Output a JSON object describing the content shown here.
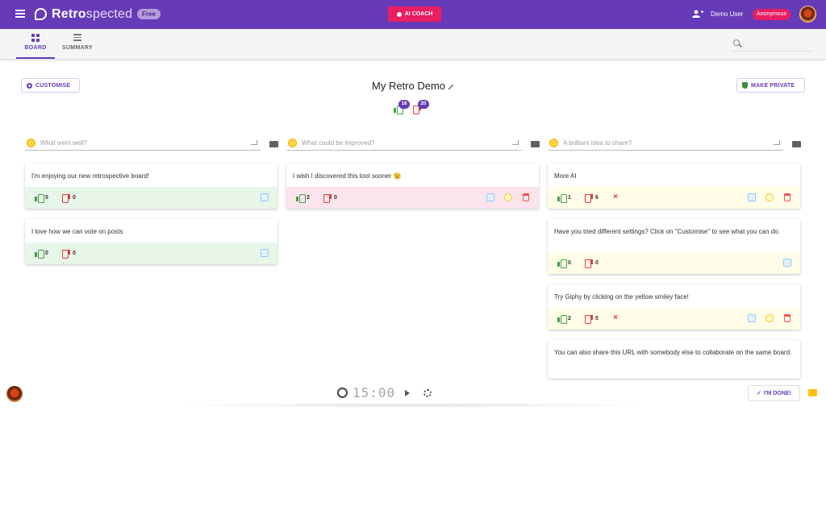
{
  "app": {
    "brand_bold": "Retro",
    "brand_light": "spected",
    "free_label": "Free",
    "ai_coach_label": "AI COACH",
    "user_name": "Demo User",
    "user_badge": "Anonymous"
  },
  "tabs": [
    {
      "label": "BOARD",
      "icon": "board-grid-icon",
      "active": true
    },
    {
      "label": "SUMMARY",
      "icon": "list-icon",
      "active": false
    }
  ],
  "search": {
    "placeholder": ""
  },
  "board": {
    "title": "My Retro Demo",
    "customise_label": "CUSTOMISE",
    "make_private_label": "MAKE PRIVATE",
    "total_up": "18",
    "total_down": "20"
  },
  "columns": [
    {
      "placeholder": "What went well?",
      "color": "#e8f5e9",
      "cards": [
        {
          "text": "I'm enjoying our new retrospective board!",
          "up": "5",
          "down": "0"
        },
        {
          "text": "I love how we can vote on posts",
          "up": "0",
          "down": "0"
        }
      ]
    },
    {
      "placeholder": "What could be improved?",
      "color": "#fce4ec",
      "cards": [
        {
          "text": "I wish I discovered this tool sooner 😉",
          "up": "2",
          "down": "0"
        }
      ]
    },
    {
      "placeholder": "A brilliant idea to share?",
      "color": "#fffde7",
      "cards": [
        {
          "text": "More AI",
          "up": "1",
          "down": "6"
        },
        {
          "text": "Have you tried different settings? Click on \"Customise\" to see what you can do.",
          "up": "0",
          "down": "0"
        },
        {
          "text": "Try Giphy by clicking on the yellow smiley face!",
          "up": "2",
          "down": "0"
        },
        {
          "text": "You can also share this URL with somebody else to collaborate on the same board.",
          "up": "",
          "down": ""
        }
      ]
    }
  ],
  "footer": {
    "timer": "15:00",
    "done_label": "I'M DONE!"
  },
  "colors": {
    "primary": "#673ab7",
    "accent": "#e91e63"
  }
}
